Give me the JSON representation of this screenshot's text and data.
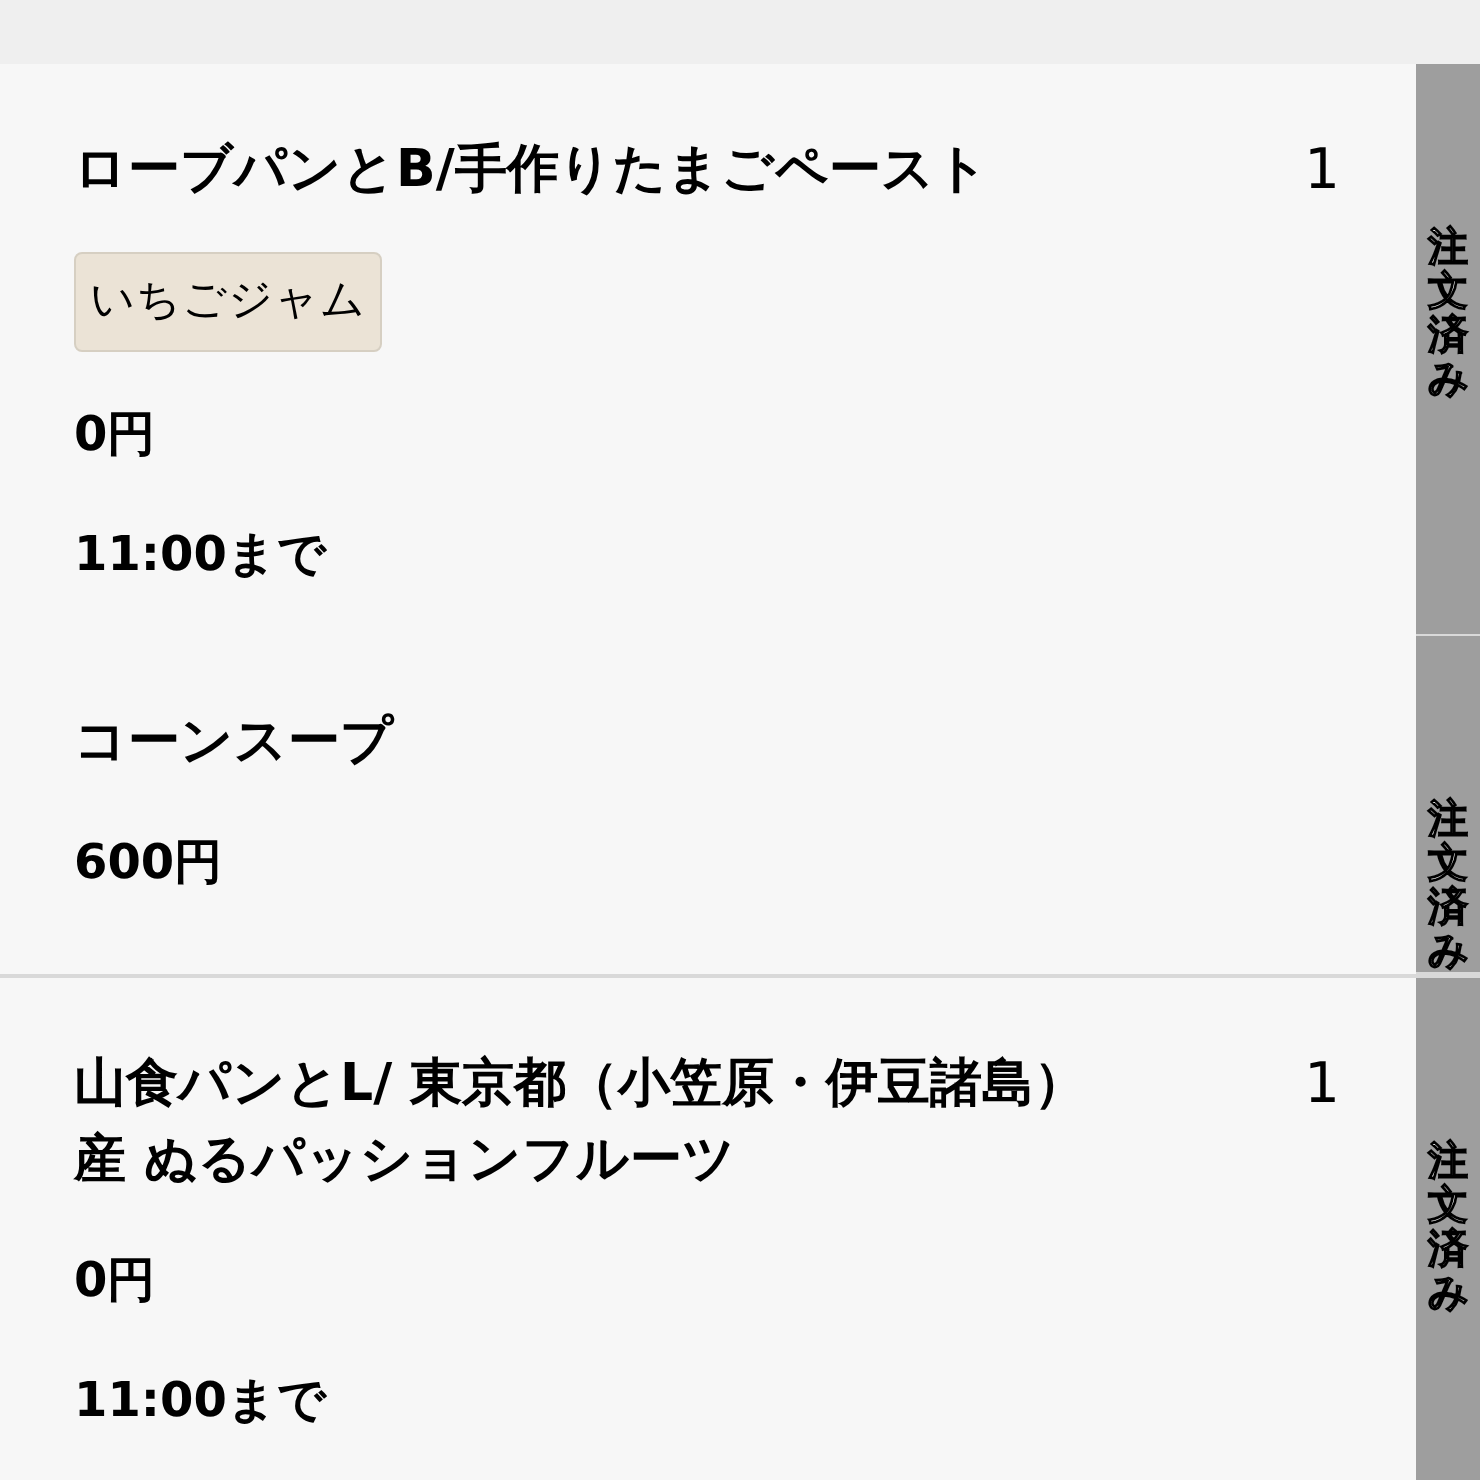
{
  "groups": [
    {
      "items": [
        {
          "name": "ローブパンとB/手作りたまごペースト",
          "quantity": "1",
          "tag": "いちごジャム",
          "price": "0円",
          "time": "11:00まで",
          "status": "注文済み"
        },
        {
          "name": "コーンスープ",
          "price": "600円",
          "status": "注文済み"
        }
      ]
    },
    {
      "items": [
        {
          "name": "山食パンとL/ 東京都（小笠原・伊豆諸島）産 ぬるパッションフルーツ",
          "quantity": "1",
          "price": "0円",
          "time": "11:00まで",
          "status": "注文済み"
        }
      ]
    }
  ]
}
